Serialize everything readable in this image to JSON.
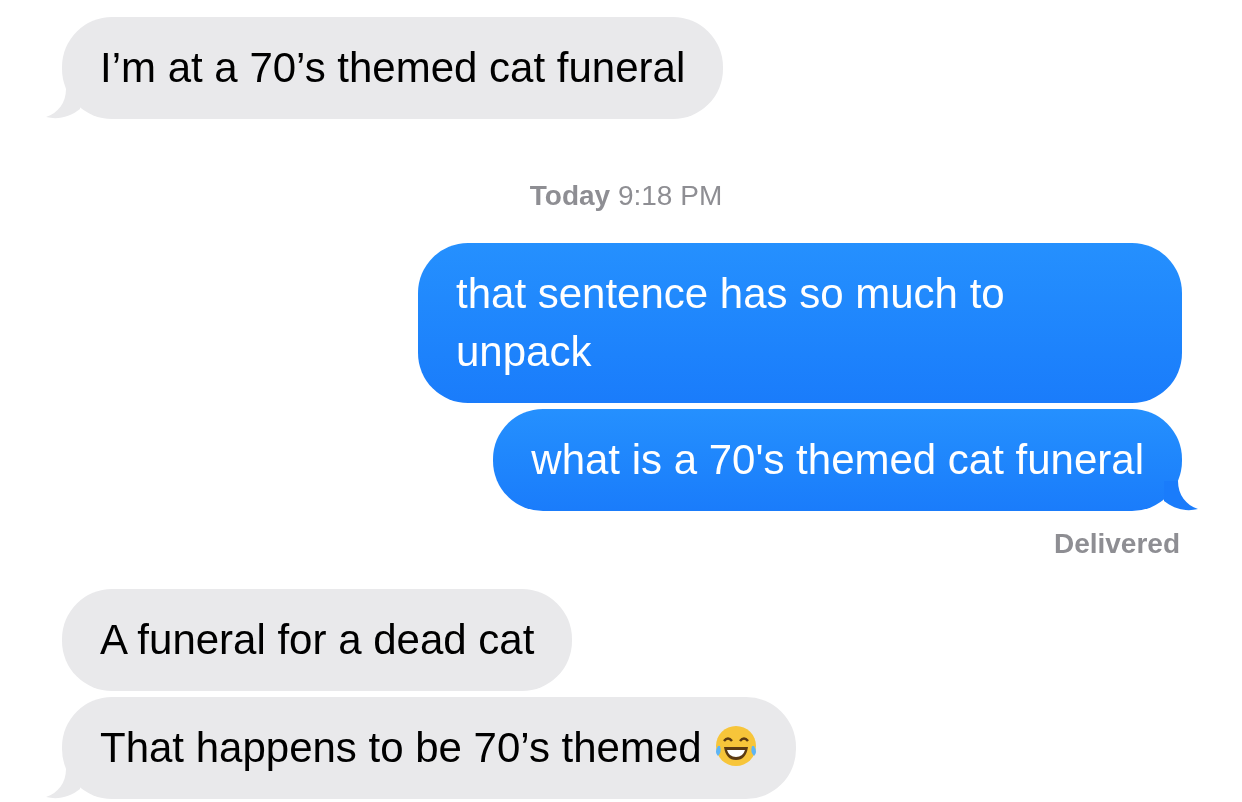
{
  "messages": [
    {
      "kind": "incoming",
      "text": "I’m at a 70’s themed cat funeral",
      "tail": true
    },
    {
      "kind": "timestamp",
      "day": "Today",
      "time": "9:18 PM"
    },
    {
      "kind": "outgoing",
      "text": "that sentence has so much to unpack",
      "tail": false
    },
    {
      "kind": "outgoing",
      "text": "what is a 70's themed cat funeral",
      "tail": true
    },
    {
      "kind": "status",
      "text": "Delivered"
    },
    {
      "kind": "incoming",
      "text": "A funeral for a dead cat",
      "tail": false
    },
    {
      "kind": "incoming",
      "text": "That happens to be 70’s themed",
      "tail": true,
      "emoji": true
    }
  ]
}
